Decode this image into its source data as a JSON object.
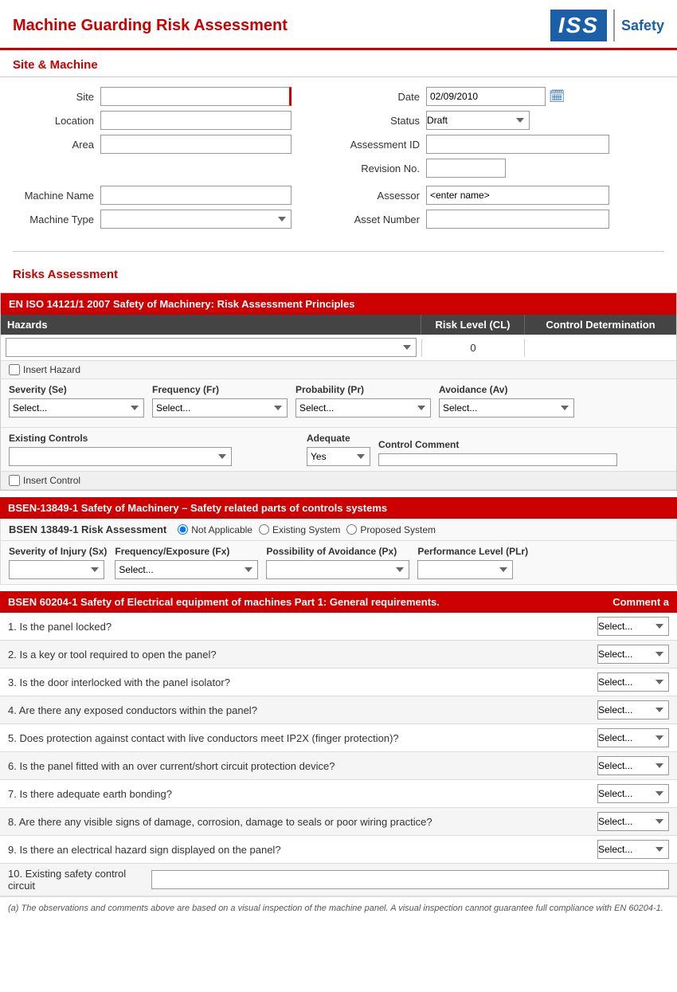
{
  "header": {
    "title": "Machine Guarding Risk Assessment",
    "logo_iss": "ISS",
    "logo_safety": "Safety"
  },
  "site_machine": {
    "section_title": "Site & Machine",
    "fields": {
      "site_label": "Site",
      "location_label": "Location",
      "area_label": "Area",
      "machine_name_label": "Machine Name",
      "machine_type_label": "Machine Type",
      "date_label": "Date",
      "date_value": "02/09/2010",
      "status_label": "Status",
      "status_value": "Draft",
      "assessment_id_label": "Assessment ID",
      "revision_no_label": "Revision No.",
      "assessor_label": "Assessor",
      "assessor_value": "<enter name>",
      "asset_number_label": "Asset Number"
    }
  },
  "risks": {
    "section_title": "Risks Assessment",
    "iso_section": {
      "header": "EN ISO 14121/1 2007 Safety of Machinery: Risk Assessment Principles",
      "col_hazards": "Hazards",
      "col_risk": "Risk Level (CL)",
      "col_control": "Control Determination",
      "risk_value": "0",
      "insert_hazard": "Insert Hazard",
      "severity_label": "Severity (Se)",
      "frequency_label": "Frequency (Fr)",
      "probability_label": "Probability (Pr)",
      "avoidance_label": "Avoidance (Av)",
      "select_placeholder": "Select...",
      "existing_controls_label": "Existing Controls",
      "adequate_label": "Adequate",
      "adequate_value": "Yes",
      "control_comment_label": "Control Comment",
      "insert_control": "Insert Control"
    },
    "bsen13849": {
      "header": "BSEN-13849-1 Safety of Machinery – Safety related parts of controls systems",
      "risk_assessment_label": "BSEN 13849-1 Risk Assessment",
      "not_applicable": "Not Applicable",
      "existing_system": "Existing System",
      "proposed_system": "Proposed System",
      "severity_label": "Severity of Injury (Sx)",
      "frequency_label": "Frequency/Exposure (Fx)",
      "possibility_label": "Possibility of Avoidance (Px)",
      "performance_label": "Performance Level (PLr)",
      "select_placeholder": "Select..."
    },
    "bsen60204": {
      "header": "BSEN 60204-1 Safety of Electrical equipment of machines Part 1: General requirements.",
      "comment_header": "Comment a",
      "questions": [
        "1.  Is the panel locked?",
        "2.  Is a key or tool required to open the panel?",
        "3.  Is the door interlocked with the panel isolator?",
        "4.  Are there any exposed conductors within the panel?",
        "5.  Does protection against contact with live conductors meet IP2X (finger protection)?",
        "6.  Is the panel fitted with an over current/short circuit protection device?",
        "7.  Is there adequate earth bonding?",
        "8.  Are there any visible signs of damage, corrosion, damage to seals or poor wiring practice?",
        "9.  Is there an electrical hazard sign displayed on the panel?",
        "10. Existing safety control circuit"
      ],
      "select_placeholder": "Select...",
      "footnote": "(a) The observations and comments above are based on a visual inspection of the machine panel.  A visual inspection cannot guarantee full compliance with EN 60204-1."
    }
  }
}
